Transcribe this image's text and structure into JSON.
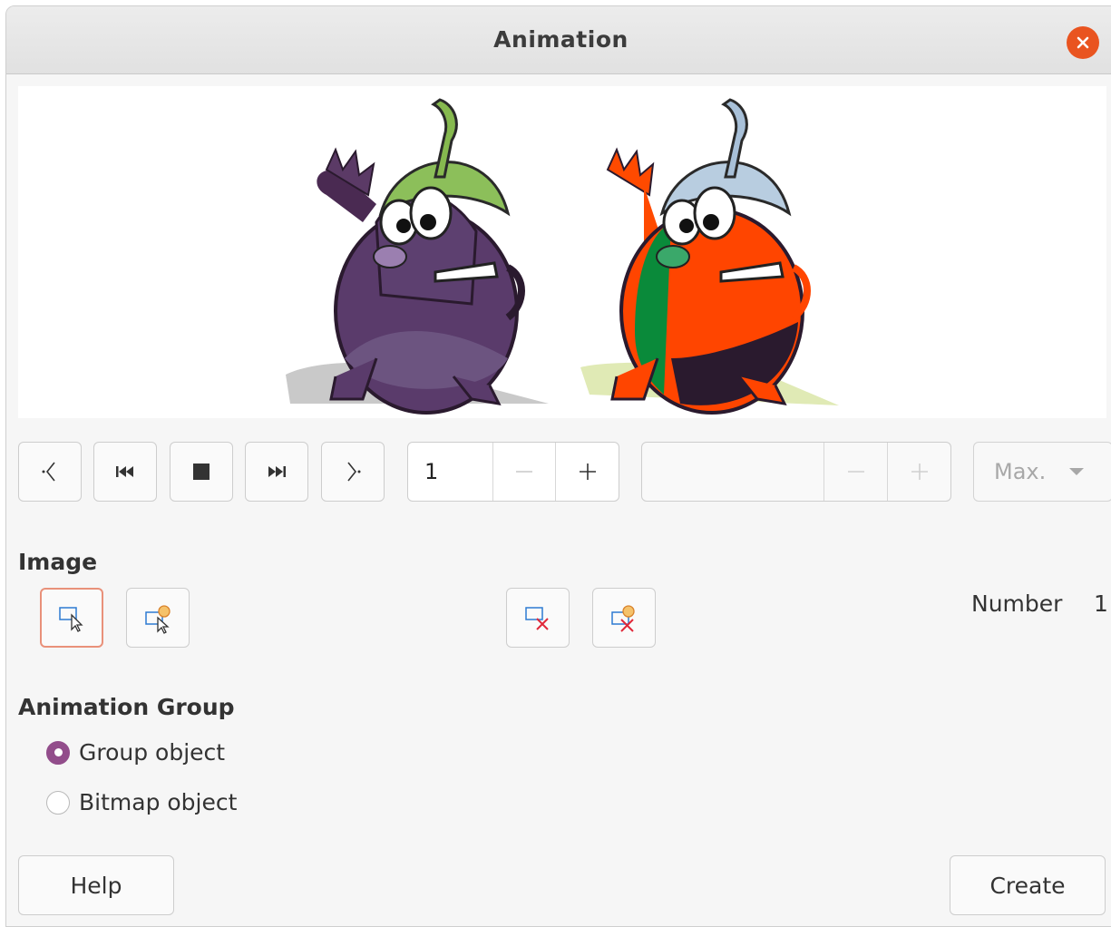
{
  "window": {
    "title": "Animation"
  },
  "spin_image": {
    "value": "1"
  },
  "spin_duration": {
    "value": ""
  },
  "loop_dropdown": {
    "selected": "Max."
  },
  "image_section": {
    "title": "Image",
    "number_label": "Number",
    "number_value": "1"
  },
  "group_section": {
    "title": "Animation Group",
    "options": [
      "Group object",
      "Bitmap object"
    ],
    "selected": "Group object"
  },
  "buttons": {
    "help": "Help",
    "create": "Create"
  },
  "colors": {
    "accent": "#e95420",
    "radio": "#924d8b",
    "active_border": "#e9917a"
  },
  "icons": [
    "close-icon",
    "first-frame-icon",
    "rewind-icon",
    "stop-icon",
    "play-icon",
    "last-frame-icon",
    "minus-icon",
    "plus-icon",
    "chevron-down-icon",
    "apply-object-icon",
    "apply-objects-individually-icon",
    "delete-current-image-icon",
    "delete-all-images-icon"
  ]
}
